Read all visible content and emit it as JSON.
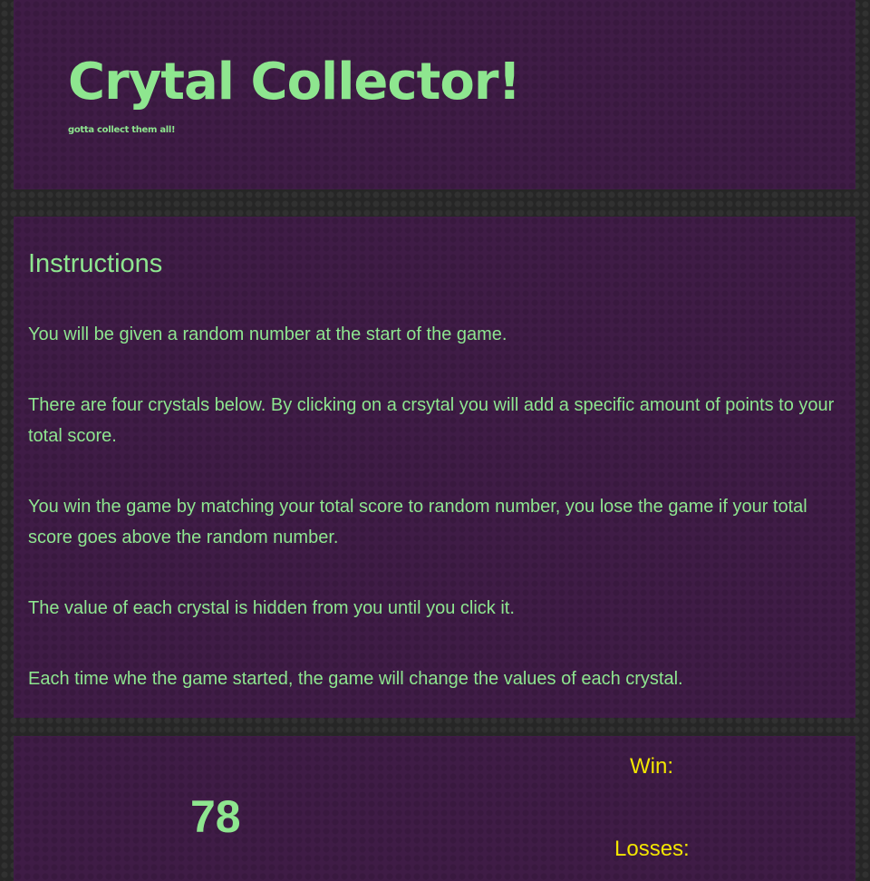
{
  "header": {
    "title": "Crytal Collector!",
    "subtitle": "gotta collect them all!"
  },
  "instructions": {
    "heading": "Instructions",
    "paragraphs": [
      "You will be given a random number at the start of the game.",
      "There are four crystals below. By clicking on a crsytal you will add a specific amount of points to your total score.",
      "You win the game by matching your total score to random number, you lose the game if your total score goes above the random number.",
      "The value of each crystal is hidden from you until you click it.",
      "Each time whe the game started, the game will change the values of each crystal."
    ]
  },
  "game": {
    "random_number": "78",
    "win_label": "Win:",
    "losses_label": "Losses:"
  },
  "colors": {
    "panel_background": "#3f1c46",
    "page_background": "#262626",
    "text_green": "#8ee68f",
    "score_yellow": "#f2e600"
  }
}
